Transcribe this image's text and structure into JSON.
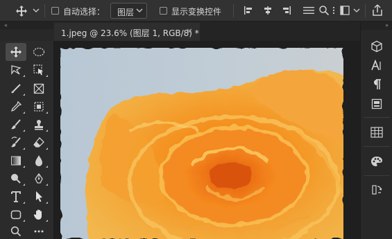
{
  "options_bar": {
    "auto_select_label": "自动选择：",
    "auto_select_checked": false,
    "target_value": "图层",
    "show_transform_label": "显示变换控件",
    "show_transform_checked": false,
    "icons": [
      "move-icon",
      "chevron-down-icon",
      "align-left-icon",
      "align-center-icon",
      "align-right-icon",
      "distribute-icon",
      "search-icon",
      "frame-icon",
      "chevron-down-icon",
      "share-icon"
    ]
  },
  "document_tab": {
    "title": "1.jpeg @ 23.6% (图层 1, RGB/8) *",
    "close_glyph": "×"
  },
  "panel_collapse": {
    "left": "«",
    "right": "»"
  },
  "tools": [
    {
      "name": "move-tool"
    },
    {
      "name": "ellipse-marquee-tool"
    },
    {
      "name": "lasso-tool"
    },
    {
      "name": "object-select-tool"
    },
    {
      "name": "brush-stroke-tool"
    },
    {
      "name": "frame-tool"
    },
    {
      "name": "eyedropper-tool"
    },
    {
      "name": "healing-patch-tool"
    },
    {
      "name": "brush-tool"
    },
    {
      "name": "stamp-tool"
    },
    {
      "name": "history-brush-tool"
    },
    {
      "name": "eraser-tool"
    },
    {
      "name": "gradient-tool"
    },
    {
      "name": "blur-tool"
    },
    {
      "name": "dodge-tool"
    },
    {
      "name": "pen-tool"
    },
    {
      "name": "type-tool"
    },
    {
      "name": "path-select-tool"
    },
    {
      "name": "rectangle-tool"
    },
    {
      "name": "hand-tool"
    },
    {
      "name": "zoom-tool"
    },
    {
      "name": "more-tools"
    }
  ],
  "right_panel_icons": [
    "3d-cube-icon",
    "character-icon",
    "paragraph-icon",
    "properties-icon",
    "swatches-grid-icon",
    "color-palette-icon",
    "history-icon"
  ],
  "colors": {
    "app_bg": "#282828",
    "options_bar_bg": "#323232",
    "canvas_bg": "#1f1f1f",
    "rose_orange": "#f0921e",
    "sky": "#b7c6d2"
  }
}
